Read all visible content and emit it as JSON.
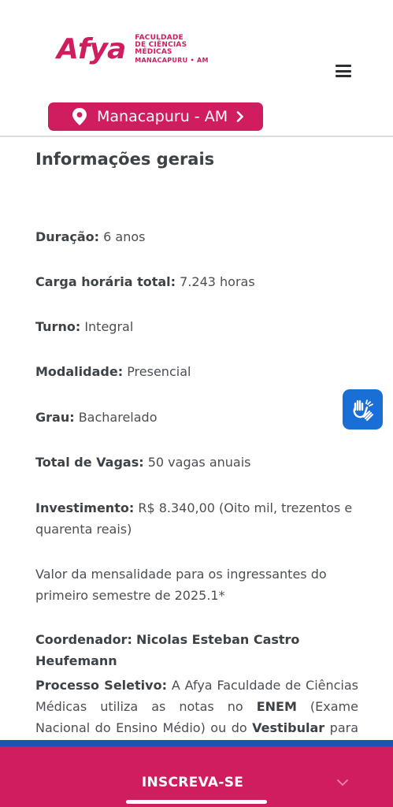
{
  "brand": {
    "logo_word": "Afya",
    "logo_lines": [
      "FACULDADE",
      "DE CIÊNCIAS",
      "MÉDICAS"
    ],
    "logo_location": "MANACAPURU • AM",
    "color": "#d01d5f"
  },
  "header": {
    "menu_icon": "hamburger-menu-icon",
    "location_label": "Manacapuru - AM"
  },
  "main": {
    "title": "Informações gerais",
    "duration_label": "Duração:",
    "duration_value": "6 anos",
    "workload_label": "Carga horária total:",
    "workload_value": "7.243 horas",
    "shift_label": "Turno:",
    "shift_value": "Integral",
    "modality_label": "Modalidade:",
    "modality_value": "Presencial",
    "degree_label": "Grau:",
    "degree_value": "Bacharelado",
    "seats_label": "Total de Vagas:",
    "seats_value": "50 vagas anuais",
    "investment_label": "Investimento:",
    "investment_value": "R$ 8.340,00 (Oito mil, trezentos e quarenta reais)",
    "monthly_note": "Valor da mensalidade para os ingressantes do primeiro semestre de 2025.1*",
    "coordinator_label": "Coordenador:",
    "coordinator_value": "Nicolas Esteban Castro Heufemann",
    "selection_label": "Processo Seletivo:",
    "selection_text_1": "A Afya Faculdade de Ciências Médicas utiliza as notas no",
    "selection_enem": "ENEM",
    "selection_text_2": "(Exame Nacional do Ensino Médio) ou do",
    "selection_vestibular": "Vestibular",
    "selection_text_3": "para o ingresso"
  },
  "accessibility": {
    "icon": "sign-language-hands-icon",
    "color": "#1a6fd6"
  },
  "footer": {
    "cta_label": "INSCREVA-SE",
    "stripe_color": "#1b55b0"
  }
}
